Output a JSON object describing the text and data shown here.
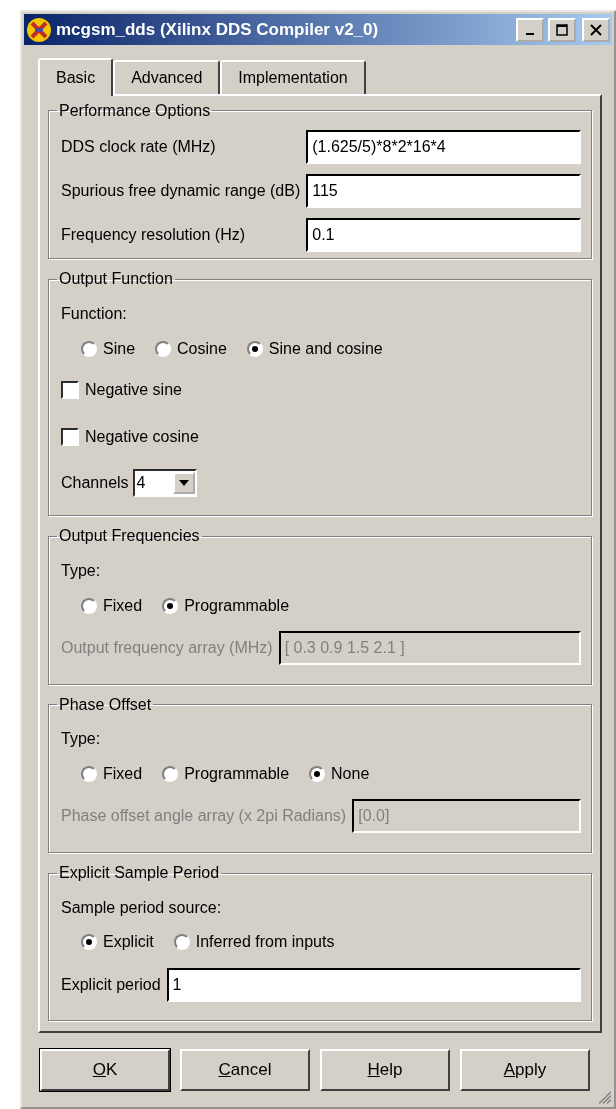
{
  "window": {
    "title": "mcgsm_dds (Xilinx DDS Compiler v2_0)"
  },
  "tabs": [
    {
      "label": "Basic",
      "selected": true
    },
    {
      "label": "Advanced",
      "selected": false
    },
    {
      "label": "Implementation",
      "selected": false
    }
  ],
  "sections": [
    {
      "title": "Performance Options",
      "rows": [
        {
          "kind": "field",
          "label": "DDS clock rate (MHz)",
          "value": "(1.625/5)*8*2*16*4",
          "disabled": false
        },
        {
          "kind": "field",
          "label": "Spurious free dynamic range (dB)",
          "value": "115",
          "disabled": false
        },
        {
          "kind": "field",
          "label": "Frequency resolution (Hz)",
          "value": "0.1",
          "disabled": false
        }
      ]
    },
    {
      "title": "Output Function",
      "rows": [
        {
          "kind": "caption",
          "text": "Function:"
        },
        {
          "kind": "radios",
          "options": [
            {
              "label": "Sine",
              "selected": false
            },
            {
              "label": "Cosine",
              "selected": false
            },
            {
              "label": "Sine and cosine",
              "selected": true
            }
          ]
        },
        {
          "kind": "checkbox",
          "label": "Negative sine",
          "checked": false
        },
        {
          "kind": "checkbox",
          "label": "Negative cosine",
          "checked": false
        },
        {
          "kind": "select",
          "label": "Channels",
          "value": "4"
        }
      ]
    },
    {
      "title": "Output Frequencies",
      "rows": [
        {
          "kind": "caption",
          "text": "Type:"
        },
        {
          "kind": "radios",
          "options": [
            {
              "label": "Fixed",
              "selected": false
            },
            {
              "label": "Programmable",
              "selected": true
            }
          ]
        },
        {
          "kind": "field",
          "label": "Output frequency array (MHz)",
          "value": "[ 0.3 0.9 1.5 2.1 ]",
          "disabled": true
        }
      ]
    },
    {
      "title": "Phase Offset",
      "rows": [
        {
          "kind": "caption",
          "text": "Type:"
        },
        {
          "kind": "radios",
          "options": [
            {
              "label": "Fixed",
              "selected": false
            },
            {
              "label": "Programmable",
              "selected": false
            },
            {
              "label": "None",
              "selected": true
            }
          ]
        },
        {
          "kind": "field",
          "label": "Phase offset angle array (x 2pi Radians)",
          "value": "[0.0]",
          "disabled": true
        }
      ]
    },
    {
      "title": "Explicit Sample Period",
      "rows": [
        {
          "kind": "caption",
          "text": "Sample period source:"
        },
        {
          "kind": "radios",
          "options": [
            {
              "label": "Explicit",
              "selected": true
            },
            {
              "label": "Inferred from inputs",
              "selected": false
            }
          ]
        },
        {
          "kind": "field",
          "label": "Explicit period",
          "value": "1",
          "disabled": false
        }
      ]
    }
  ],
  "buttons": [
    {
      "underlined": "O",
      "rest": "K",
      "default": true
    },
    {
      "underlined": "C",
      "rest": "ancel",
      "default": false
    },
    {
      "underlined": "H",
      "rest": "elp",
      "default": false
    },
    {
      "underlined": "A",
      "rest": "pply",
      "default": false
    }
  ]
}
